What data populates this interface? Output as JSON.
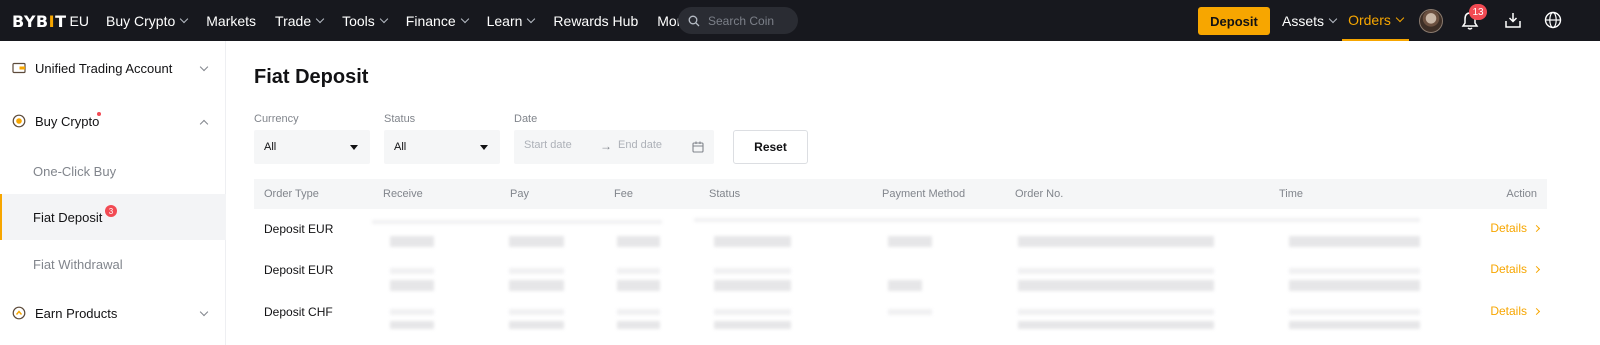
{
  "brand": {
    "logo": "BYBIT",
    "region": "EU",
    "accent": "#f7a600"
  },
  "nav": {
    "items": [
      {
        "label": "Buy Crypto",
        "chevron": true
      },
      {
        "label": "Markets",
        "chevron": false
      },
      {
        "label": "Trade",
        "chevron": true
      },
      {
        "label": "Tools",
        "chevron": true
      },
      {
        "label": "Finance",
        "chevron": true
      },
      {
        "label": "Learn",
        "chevron": true
      },
      {
        "label": "Rewards Hub",
        "chevron": false
      },
      {
        "label": "More",
        "chevron": true
      }
    ],
    "search_placeholder": "Search Coin",
    "deposit_label": "Deposit",
    "assets_label": "Assets",
    "orders_label": "Orders",
    "notification_count": "13"
  },
  "sidebar": {
    "unified": "Unified Trading Account",
    "buy_crypto": "Buy Crypto",
    "items": [
      "One-Click Buy",
      "Fiat Deposit",
      "Fiat Withdrawal"
    ],
    "fiat_deposit_badge": "3",
    "earn": "Earn Products"
  },
  "main": {
    "title": "Fiat Deposit",
    "filters": {
      "currency_label": "Currency",
      "currency_value": "All",
      "status_label": "Status",
      "status_value": "All",
      "date_label": "Date",
      "start_placeholder": "Start date",
      "end_placeholder": "End date",
      "reset_label": "Reset"
    },
    "columns": [
      "Order Type",
      "Receive",
      "Pay",
      "Fee",
      "Status",
      "Payment Method",
      "Order No.",
      "Time",
      "Action"
    ],
    "rows": [
      {
        "order_type": "Deposit EUR",
        "action": "Details"
      },
      {
        "order_type": "Deposit EUR",
        "action": "Details"
      },
      {
        "order_type": "Deposit CHF",
        "action": "Details"
      }
    ]
  }
}
